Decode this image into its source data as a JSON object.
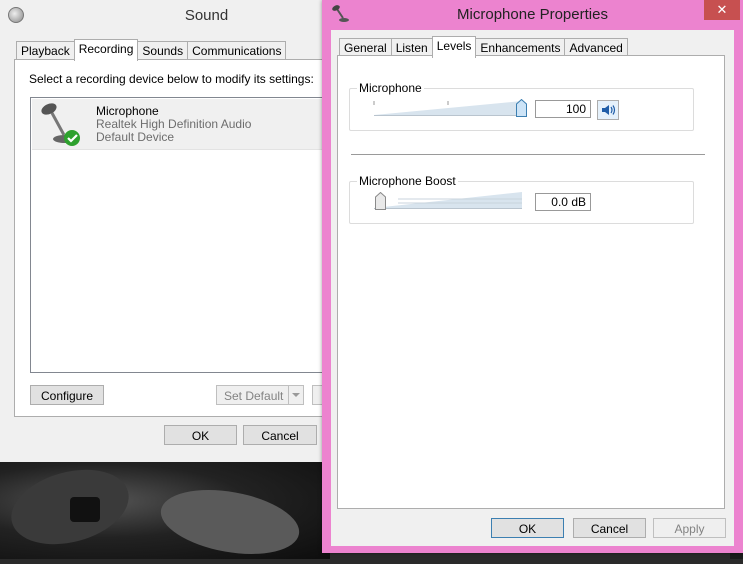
{
  "sound": {
    "title": "Sound",
    "tabs": [
      "Playback",
      "Recording",
      "Sounds",
      "Communications"
    ],
    "instruction": "Select a recording device below to modify its settings:",
    "device": {
      "name": "Microphone",
      "driver": "Realtek High Definition Audio",
      "status": "Default Device"
    },
    "configure_label": "Configure",
    "set_default_label": "Set Default",
    "ok_label": "OK",
    "cancel_label": "Cancel"
  },
  "props": {
    "title": "Microphone Properties",
    "close_glyph": "✕",
    "tabs": [
      "General",
      "Listen",
      "Levels",
      "Enhancements",
      "Advanced"
    ],
    "microphone_label": "Microphone",
    "microphone_value": "100",
    "boost_label": "Microphone Boost",
    "boost_value": "0.0 dB",
    "ok_label": "OK",
    "cancel_label": "Cancel",
    "apply_label": "Apply"
  },
  "levels": {
    "microphone": 1.0,
    "boost": 0.0
  },
  "colors": {
    "window_accent": "#ec83cf",
    "close": "#c75050",
    "check": "#2ea12e"
  }
}
